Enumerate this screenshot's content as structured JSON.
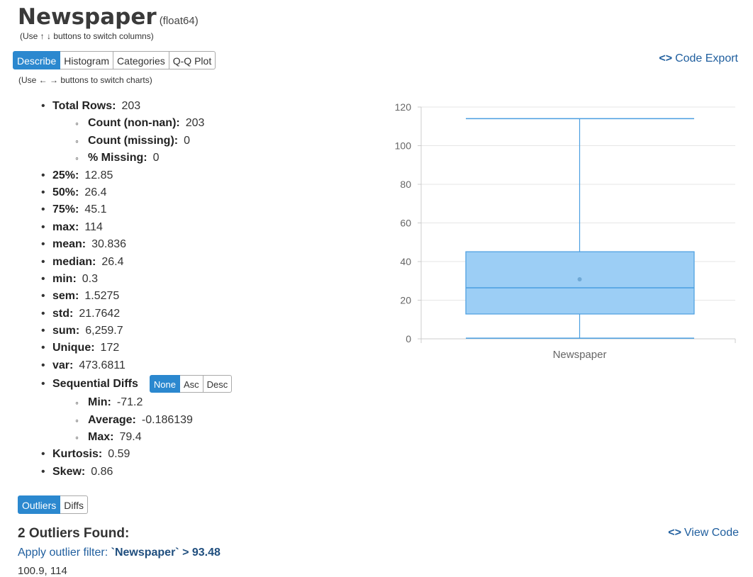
{
  "header": {
    "title": "Newspaper",
    "dtype": "(float64)",
    "column_hint": "(Use ↑ ↓ buttons to switch columns)"
  },
  "tabs": [
    "Describe",
    "Histogram",
    "Categories",
    "Q-Q Plot"
  ],
  "active_tab": "Describe",
  "chart_hint": "(Use ← → buttons to switch charts)",
  "code_export": {
    "icon": "<>",
    "label": "Code Export"
  },
  "stats": {
    "total_rows": {
      "label": "Total Rows:",
      "value": "203"
    },
    "count_nonnan": {
      "label": "Count (non-nan):",
      "value": "203"
    },
    "count_missing": {
      "label": "Count (missing):",
      "value": "0"
    },
    "pct_missing": {
      "label": "% Missing:",
      "value": "0"
    },
    "p25": {
      "label": "25%:",
      "value": "12.85"
    },
    "p50": {
      "label": "50%:",
      "value": "26.4"
    },
    "p75": {
      "label": "75%:",
      "value": "45.1"
    },
    "max": {
      "label": "max:",
      "value": "114"
    },
    "mean": {
      "label": "mean:",
      "value": "30.836"
    },
    "median": {
      "label": "median:",
      "value": "26.4"
    },
    "min": {
      "label": "min:",
      "value": "0.3"
    },
    "sem": {
      "label": "sem:",
      "value": "1.5275"
    },
    "std": {
      "label": "std:",
      "value": "21.7642"
    },
    "sum": {
      "label": "sum:",
      "value": "6,259.7"
    },
    "unique": {
      "label": "Unique:",
      "value": "172"
    },
    "var": {
      "label": "var:",
      "value": "473.6811"
    },
    "seq_diffs": {
      "label": "Sequential Diffs",
      "buttons": [
        "None",
        "Asc",
        "Desc"
      ],
      "active": "None"
    },
    "seq_min": {
      "label": "Min:",
      "value": "-71.2"
    },
    "seq_avg": {
      "label": "Average:",
      "value": "-0.186139"
    },
    "seq_max": {
      "label": "Max:",
      "value": "79.4"
    },
    "kurtosis": {
      "label": "Kurtosis:",
      "value": "0.59"
    },
    "skew": {
      "label": "Skew:",
      "value": "0.86"
    }
  },
  "bottom_tabs": [
    "Outliers",
    "Diffs"
  ],
  "bottom_active": "Outliers",
  "outliers": {
    "heading": "2 Outliers Found:",
    "filter_prefix": "Apply outlier filter: ",
    "filter_expr": "`Newspaper` > 93.48",
    "values": "100.9, 114",
    "view_code_icon": "<>",
    "view_code_label": "View Code"
  },
  "chart_data": {
    "type": "box",
    "categories": [
      "Newspaper"
    ],
    "series": [
      {
        "min": 0.3,
        "q1": 12.85,
        "median": 26.4,
        "q3": 45.1,
        "max": 114,
        "mean": 30.836
      }
    ],
    "ylim": [
      0,
      120
    ],
    "yticks": [
      "0",
      "20",
      "40",
      "60",
      "80",
      "100",
      "120"
    ],
    "grid": true,
    "colors": {
      "box_fill": "#9ccef5",
      "box_stroke": "#4a9ee0",
      "grid": "#e6e6e6",
      "axis": "#cccccc"
    }
  }
}
